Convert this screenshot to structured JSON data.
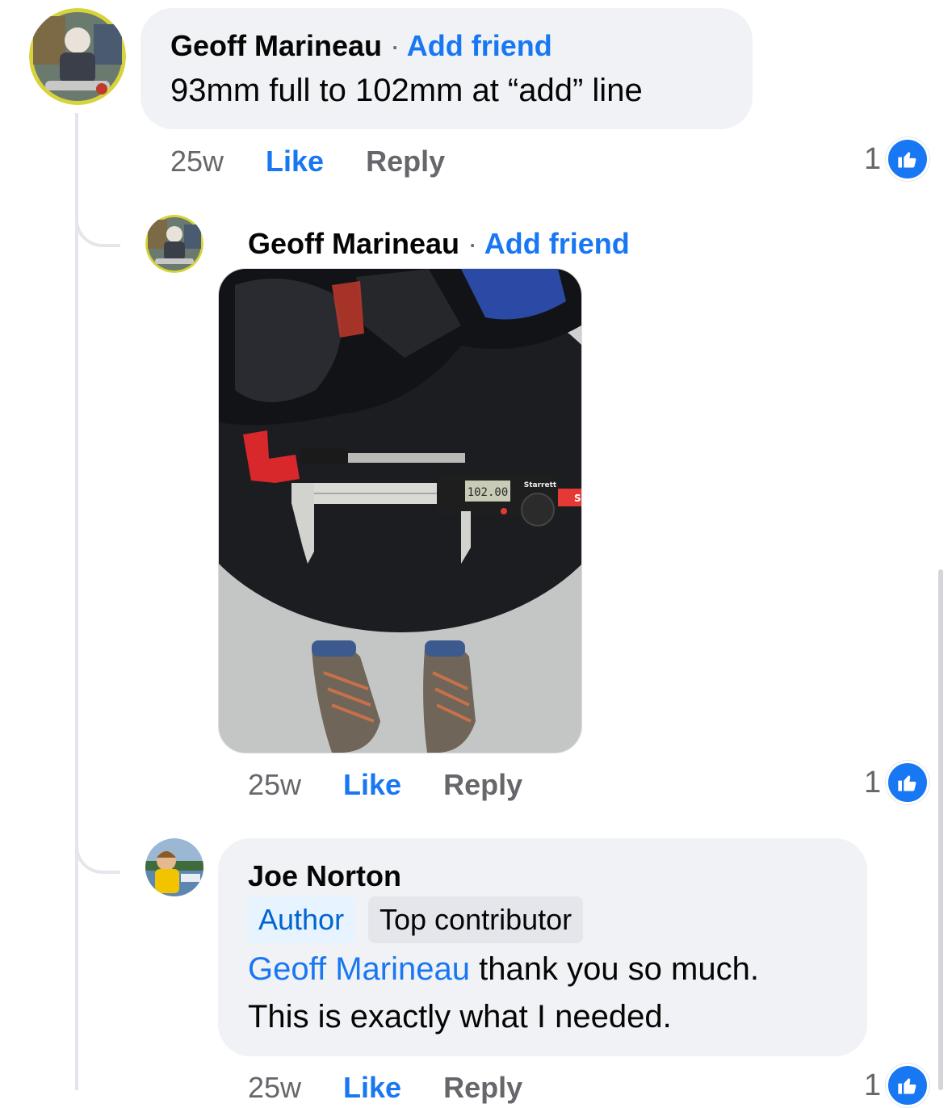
{
  "comments": [
    {
      "author": "Geoff Marineau",
      "separator": "·",
      "add_friend": "Add friend",
      "text": "93mm full to 102mm at “add” line",
      "time": "25w",
      "like": "Like",
      "reply": "Reply",
      "reaction_count": "1"
    },
    {
      "author": "Geoff Marineau",
      "separator": "·",
      "add_friend": "Add friend",
      "photo": {
        "device_brand": "Starrett",
        "display_reading": "102.00",
        "tag_text": "S"
      },
      "time": "25w",
      "like": "Like",
      "reply": "Reply",
      "reaction_count": "1"
    },
    {
      "author": "Joe Norton",
      "badges": [
        "Author",
        "Top contributor"
      ],
      "mention": "Geoff Marineau",
      "text_line1_rest": " thank you so much.",
      "text_line2": "This is exactly what I needed.",
      "time": "25w",
      "like": "Like",
      "reply": "Reply",
      "reaction_count": "1"
    }
  ],
  "colors": {
    "link_blue": "#1877f2",
    "bubble_bg": "#f0f2f5",
    "secondary_text": "#65676b"
  },
  "icons": [
    "thumbs-up-icon"
  ]
}
